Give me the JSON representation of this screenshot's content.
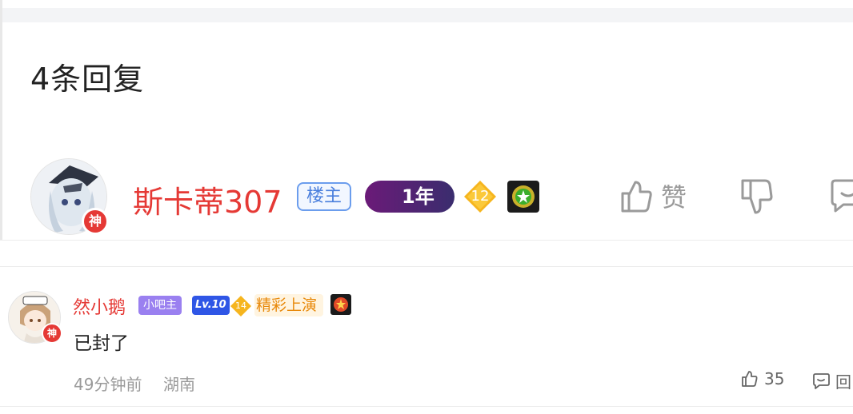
{
  "header": {
    "reply_count": "4条回复"
  },
  "op": {
    "username": "斯卡蒂307",
    "avatar_icon": "anime-character-avatar-icon",
    "god_badge": "神",
    "role_badge": "楼主",
    "membership_badge": "1年",
    "level": "12",
    "like_label": "赞",
    "colors": {
      "name": "#e53935",
      "role_border": "#6b9ded",
      "membership": "#6b1a78"
    }
  },
  "sub_reply": {
    "username": "然小鹅",
    "god_badge": "神",
    "role_badge": "小吧主",
    "lv_badge": "Lv.10",
    "level": "14",
    "title_badge": "精彩上演",
    "content": "已封了",
    "time": "49分钟前",
    "location": "湖南",
    "like_count": "35",
    "reply_label": "回"
  }
}
